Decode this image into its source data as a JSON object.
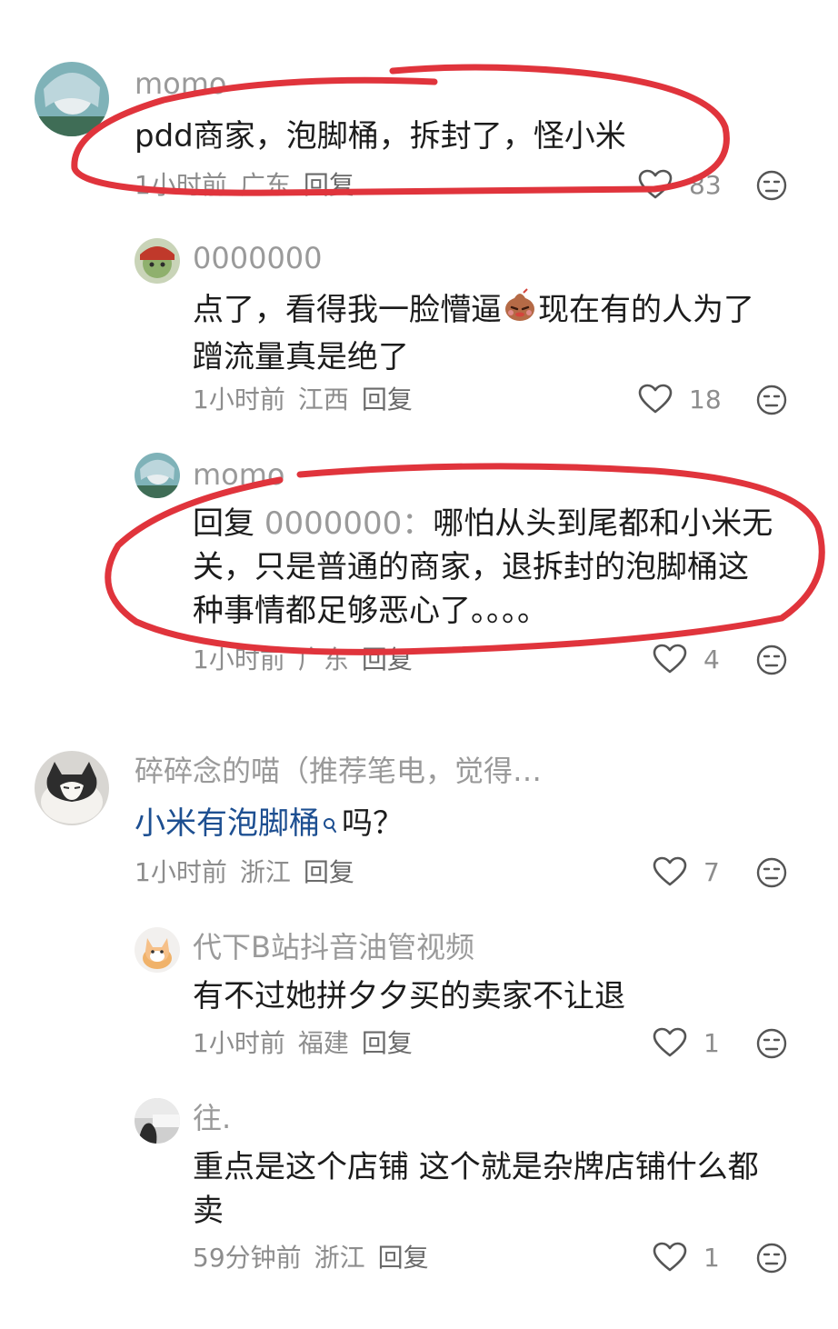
{
  "comments": [
    {
      "user": "momo",
      "text": "pdd商家，泡脚桶，拆封了，怪小米",
      "time": "1小时前",
      "location": "广东",
      "reply_label": "回复",
      "likes": "83"
    },
    {
      "user": "0000000",
      "text_a": "点了，看得我一脸懵逼",
      "text_b": "现在有的人为了",
      "text_c": "蹭流量真是绝了",
      "time": "1小时前",
      "location": "江西",
      "reply_label": "回复",
      "likes": "18"
    },
    {
      "user": "momo",
      "reply_prefix": "回复",
      "reply_to": "0000000：",
      "text_a": "哪怕从头到尾都和小米无",
      "text_b": "关，只是普通的商家，退拆封的泡脚桶这",
      "text_c": "种事情都足够恶心了。。。。",
      "time": "1小时前",
      "location": "广东",
      "reply_label": "回复",
      "likes": "4"
    },
    {
      "user": "碎碎念的喵（推荐笔电，觉得…",
      "link_text": "小米有泡脚桶",
      "text_rest": "吗？",
      "time": "1小时前",
      "location": "浙江",
      "reply_label": "回复",
      "likes": "7"
    },
    {
      "user": "代下B站抖音油管视频",
      "text": "有不过她拼夕夕买的卖家不让退",
      "time": "1小时前",
      "location": "福建",
      "reply_label": "回复",
      "likes": "1"
    },
    {
      "user": "往.",
      "text_a": "重点是这个店铺 这个就是杂牌店铺什么都",
      "text_b": "卖",
      "time": "59分钟前",
      "location": "浙江",
      "reply_label": "回复",
      "likes": "1"
    }
  ],
  "icons": {
    "like": "heart-outline-icon",
    "dislike": "neutral-face-icon",
    "search": "search-icon"
  },
  "colors": {
    "annotation_red": "#e0343c",
    "link": "#1d4f91",
    "muted": "#8d8d8d"
  }
}
